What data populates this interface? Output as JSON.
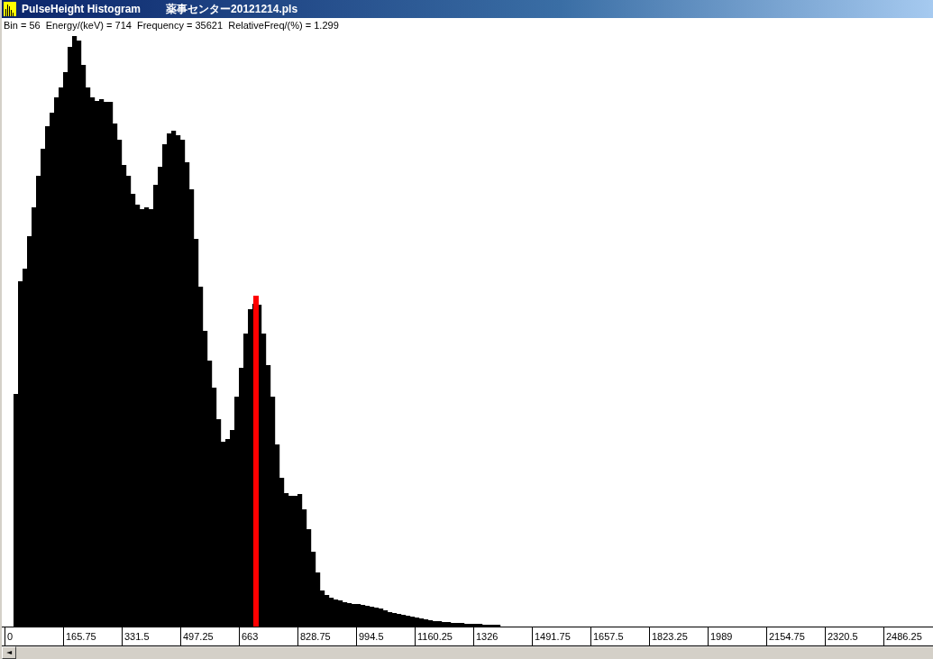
{
  "window": {
    "title": "PulseHeight Histogram",
    "file": "薬事センター20121214.pls"
  },
  "info": "Bin = 56  Energy/(keV) = 714  Frequency = 35621  RelativeFreq/(%) = 1.299",
  "axis_labels": [
    "0",
    "165.75",
    "331.5",
    "497.25",
    "663",
    "828.75",
    "994.5",
    "1160.25",
    "1326",
    "1491.75",
    "1657.5",
    "1823.25",
    "1989",
    "2154.75",
    "2320.5",
    "2486.25"
  ],
  "scrollbar": {
    "left_arrow": "◄"
  }
}
